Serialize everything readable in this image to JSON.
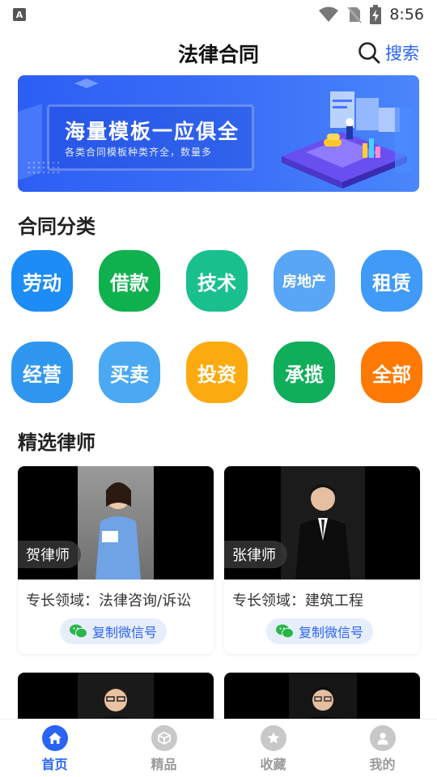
{
  "status_bar": {
    "time": "8:56",
    "left_icon": "A"
  },
  "header": {
    "title": "法律合同",
    "search_label": "搜索"
  },
  "banner": {
    "title": "海量模板一应俱全",
    "subtitle": "各类合同模板种类齐全，数量多"
  },
  "categories": {
    "title": "合同分类",
    "items": [
      {
        "label": "劳动",
        "color": "#1e8cf6"
      },
      {
        "label": "借款",
        "color": "#0fb14e"
      },
      {
        "label": "技术",
        "color": "#19c08e"
      },
      {
        "label": "房地产",
        "color": "#5aa6f6"
      },
      {
        "label": "租赁",
        "color": "#3f9af8"
      },
      {
        "label": "经营",
        "color": "#2f97f0"
      },
      {
        "label": "买卖",
        "color": "#4aa9f2"
      },
      {
        "label": "投资",
        "color": "#fbab0f"
      },
      {
        "label": "承揽",
        "color": "#10ad5a"
      },
      {
        "label": "全部",
        "color": "#ff7a05"
      }
    ]
  },
  "lawyers": {
    "title": "精选律师",
    "items": [
      {
        "name": "贺律师",
        "specialty": "专长领域：法律咨询/诉讼",
        "wechat_label": "复制微信号"
      },
      {
        "name": "张律师",
        "specialty": "专长领域：建筑工程",
        "wechat_label": "复制微信号"
      }
    ]
  },
  "bottom_nav": {
    "items": [
      {
        "label": "首页",
        "icon": "home-icon",
        "active": true
      },
      {
        "label": "精品",
        "icon": "box-icon",
        "active": false
      },
      {
        "label": "收藏",
        "icon": "star-icon",
        "active": false
      },
      {
        "label": "我的",
        "icon": "user-icon",
        "active": false
      }
    ]
  },
  "colors": {
    "accent": "#2a63f5",
    "wechat_green": "#2bb64a"
  }
}
